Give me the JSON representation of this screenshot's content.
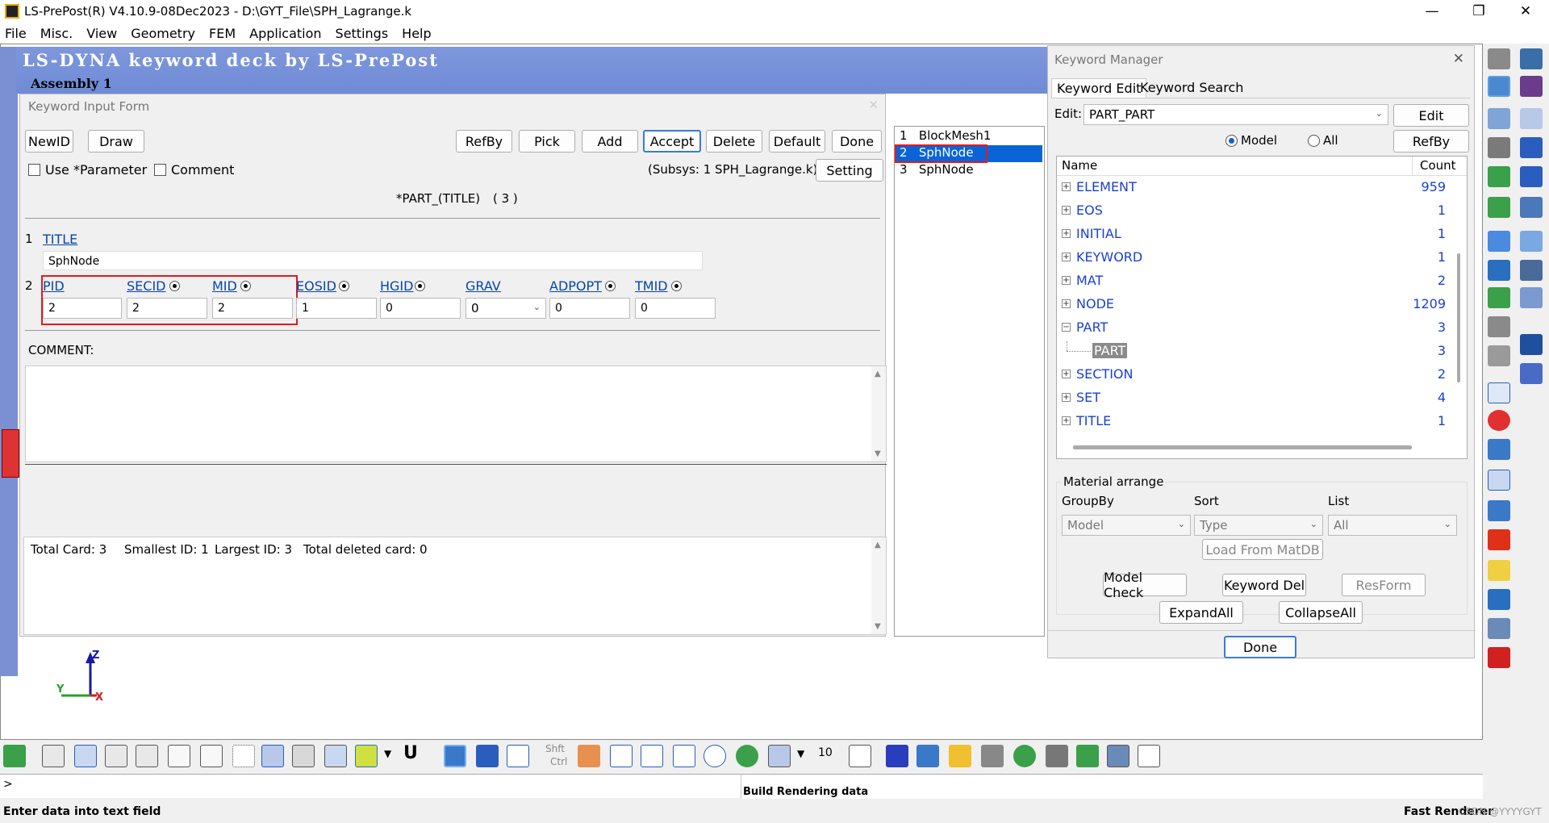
{
  "window": {
    "title": "LS-PrePost(R) V4.10.9-08Dec2023 - D:\\GYT_File\\SPH_Lagrange.k"
  },
  "menu": [
    "File",
    "Misc.",
    "View",
    "Geometry",
    "FEM",
    "Application",
    "Settings",
    "Help"
  ],
  "banner": {
    "title": "LS-DYNA keyword deck by LS-PrePost",
    "assembly": "Assembly 1"
  },
  "kif": {
    "header": "Keyword Input Form",
    "buttons": {
      "newid": "NewID",
      "draw": "Draw",
      "refby": "RefBy",
      "pick": "Pick",
      "add": "Add",
      "accept": "Accept",
      "delete": "Delete",
      "default": "Default",
      "done": "Done",
      "setting": "Setting"
    },
    "use_param": "Use *Parameter",
    "comment_chk": "Comment",
    "subsys": "(Subsys: 1 SPH_Lagrange.k)",
    "keyword": "*PART_(TITLE)",
    "count": "( 3 )",
    "card1": {
      "num": "1",
      "label": "TITLE",
      "value": "SphNode"
    },
    "card2": {
      "num": "2",
      "labels": [
        "PID",
        "SECID",
        "MID",
        "EOSID",
        "HGID",
        "GRAV",
        "ADPOPT",
        "TMID"
      ],
      "values": [
        "2",
        "2",
        "2",
        "1",
        "0",
        "0",
        "0",
        "0"
      ]
    },
    "comment_label": "COMMENT:",
    "stats": {
      "total_card": "Total Card: 3",
      "smallest": "Smallest ID: 1",
      "largest": "Largest ID: 3",
      "deleted": "Total deleted card:  0"
    }
  },
  "part_list": [
    {
      "id": "1",
      "name": "BlockMesh1"
    },
    {
      "id": "2",
      "name": "SphNode"
    },
    {
      "id": "3",
      "name": "SphNode"
    }
  ],
  "km": {
    "header": "Keyword Manager",
    "tabs": [
      "Keyword Edit",
      "Keyword Search"
    ],
    "edit_label": "Edit:",
    "edit_value": "PART_PART",
    "edit_btn": "Edit",
    "radio_model": "Model",
    "radio_all": "All",
    "refby": "RefBy",
    "col_name": "Name",
    "col_count": "Count",
    "rows": [
      {
        "name": "ELEMENT",
        "count": "959",
        "sign": "+"
      },
      {
        "name": "EOS",
        "count": "1",
        "sign": "+"
      },
      {
        "name": "INITIAL",
        "count": "1",
        "sign": "+"
      },
      {
        "name": "KEYWORD",
        "count": "1",
        "sign": "+"
      },
      {
        "name": "MAT",
        "count": "2",
        "sign": "+"
      },
      {
        "name": "NODE",
        "count": "1209",
        "sign": "+"
      },
      {
        "name": "PART",
        "count": "3",
        "sign": "−"
      },
      {
        "name": "PART",
        "count": "3",
        "sign": ""
      },
      {
        "name": "SECTION",
        "count": "2",
        "sign": "+"
      },
      {
        "name": "SET",
        "count": "4",
        "sign": "+"
      },
      {
        "name": "TITLE",
        "count": "1",
        "sign": "+"
      }
    ],
    "material_arrange": "Material arrange",
    "groupby_label": "GroupBy",
    "sort_label": "Sort",
    "list_label": "List",
    "groupby_value": "Model",
    "sort_value": "Type",
    "list_value": "All",
    "load_matdb": "Load From MatDB",
    "model_check": "Model Check",
    "keyword_del": "Keyword Del",
    "resform": "ResForm",
    "expandall": "ExpandAll",
    "collapseall": "CollapseAll",
    "done": "Done"
  },
  "bottom": {
    "shft": "Shft",
    "ctrl": "Ctrl",
    "num10": "10",
    "u_label": "U",
    "prompt": ">",
    "message": "Build Rendering data"
  },
  "status": {
    "left": "Enter data into text field",
    "right": "Fast Renderer",
    "watermark": "CSDN @YYYYGYT"
  },
  "axes": {
    "z": "Z",
    "x": "X",
    "y": "Y"
  }
}
